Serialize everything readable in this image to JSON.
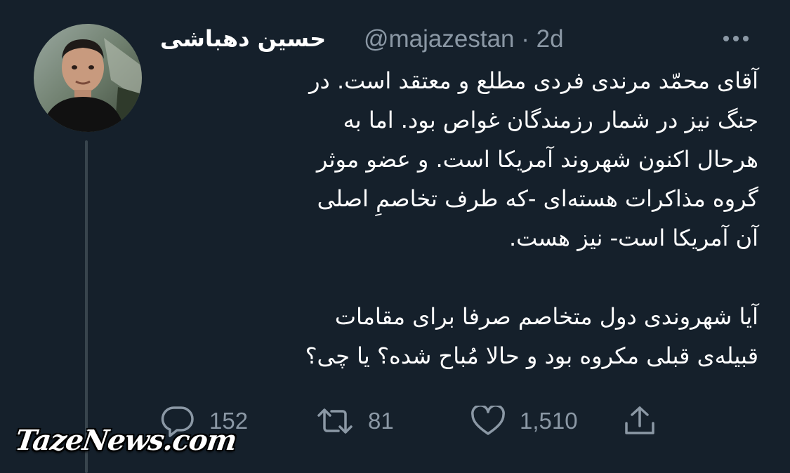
{
  "tweet": {
    "author": {
      "display_name": "حسین دهباشی",
      "handle_time": "@majazestan · 2d"
    },
    "text_lines": [
      "آقای محمّد مرندی فردی مطلع و معتقد است. در",
      "جنگ نیز در شمار رزمندگان غواص بود. اما به",
      "هرحال اکنون شهروند آمریکا است. و عضو موثر",
      "گروه مذاکرات هسته‌ای -که طرف تخاصمِ اصلی",
      "آن آمریکا است- نیز هست.",
      "آیا شهروندی دول متخاصم صرفا برای مقامات",
      "قبیله‌ی قبلی مکروه بود و حالا مُباح شده؟ یا چی؟"
    ],
    "actions": {
      "replies": "152",
      "retweets": "81",
      "likes": "1,510"
    }
  },
  "icons": {
    "more": "more-horizontal-icon",
    "reply": "reply-bubble-icon",
    "retweet": "retweet-icon",
    "like": "heart-icon",
    "share": "share-upload-icon"
  },
  "colors": {
    "background": "#15202b",
    "text": "#ffffff",
    "muted": "#8b98a5",
    "thread_line": "#38444d"
  },
  "watermark": "TazeNews.com"
}
